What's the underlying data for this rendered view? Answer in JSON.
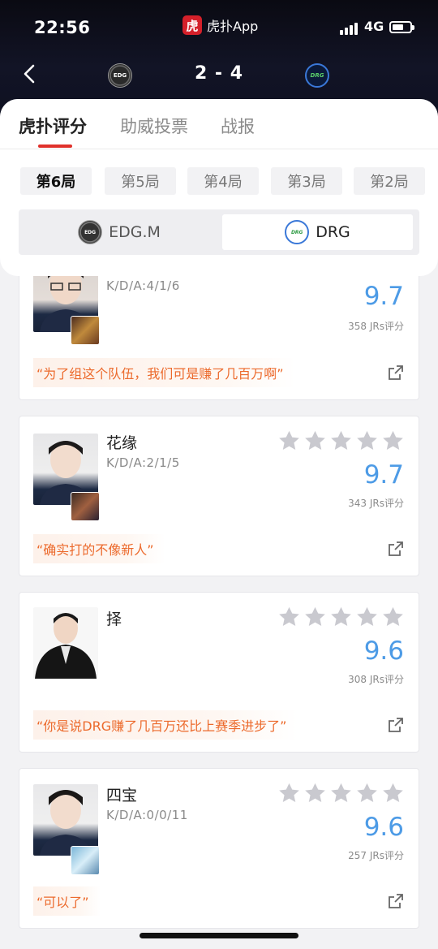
{
  "status": {
    "time": "22:56",
    "app_label": "虎扑App",
    "app_icon_char": "虎",
    "network": "4G"
  },
  "match": {
    "score": "2 - 4",
    "team_left_logo": "EDG",
    "team_right_logo": "DRG"
  },
  "tabs": [
    "虎扑评分",
    "助威投票",
    "战报"
  ],
  "games": [
    "第6局",
    "第5局",
    "第4局",
    "第3局",
    "第2局"
  ],
  "team_switch": {
    "left": "EDG.M",
    "right": "DRG",
    "left_logo": "EDG",
    "right_logo": "DRG"
  },
  "players": [
    {
      "name": "",
      "kda": "K/D/A:4/1/6",
      "rating": "9.7",
      "votes": "358 JRs评分",
      "quote": "“为了组这个队伍，我们可是赚了几百万啊”"
    },
    {
      "name": "花缘",
      "kda": "K/D/A:2/1/5",
      "rating": "9.7",
      "votes": "343 JRs评分",
      "quote": "“确实打的不像新人”"
    },
    {
      "name": "择",
      "kda": "",
      "rating": "9.6",
      "votes": "308 JRs评分",
      "quote": "“你是说DRG赚了几百万还比上赛季进步了”"
    },
    {
      "name": "四宝",
      "kda": "K/D/A:0/0/11",
      "rating": "9.6",
      "votes": "257 JRs评分",
      "quote": "“可以了”"
    }
  ],
  "colors": {
    "accent_red": "#e0312b",
    "rating_blue": "#4d9be6",
    "quote_orange": "#ec6a2c",
    "star_gray": "#c9c9cf"
  },
  "icons": {
    "back": "chevron-left-icon",
    "star": "star-icon",
    "share": "share-external-icon"
  }
}
